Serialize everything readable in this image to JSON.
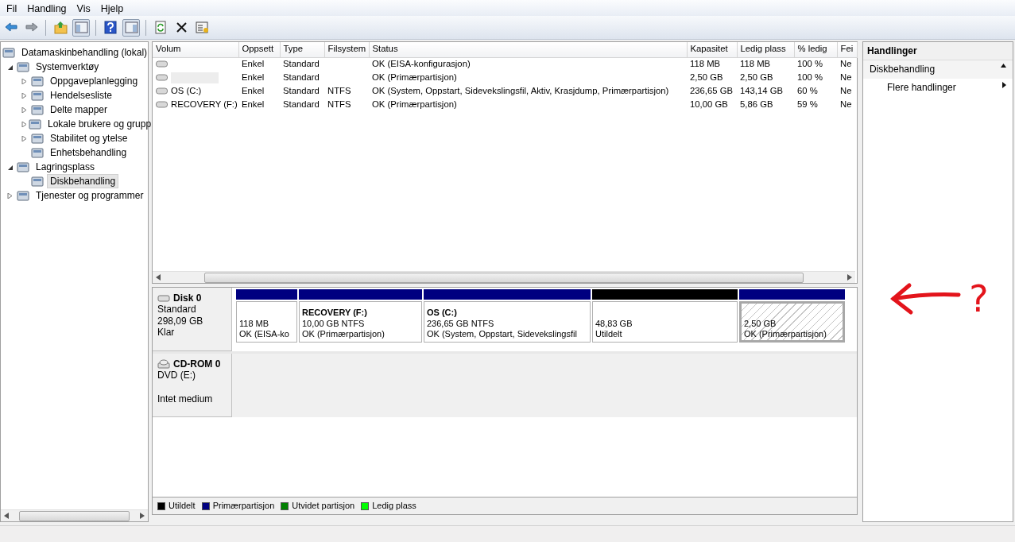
{
  "menu": [
    "Fil",
    "Handling",
    "Vis",
    "Hjelp"
  ],
  "toolbar": [
    {
      "kind": "back",
      "pressed": false
    },
    {
      "kind": "forward",
      "pressed": false
    },
    {
      "kind": "sep"
    },
    {
      "kind": "up",
      "pressed": false
    },
    {
      "kind": "tree",
      "pressed": true
    },
    {
      "kind": "sep"
    },
    {
      "kind": "help",
      "pressed": false
    },
    {
      "kind": "pane",
      "pressed": true
    },
    {
      "kind": "sep"
    },
    {
      "kind": "refresh",
      "pressed": false
    },
    {
      "kind": "delete",
      "pressed": false
    },
    {
      "kind": "properties",
      "pressed": false
    }
  ],
  "tree": [
    {
      "label": "Datamaskinbehandling (lokal)",
      "selected": false,
      "children": [
        {
          "label": "Systemverktøy",
          "expanded": true,
          "selected": false,
          "children": [
            {
              "label": "Oppgaveplanlegging",
              "expanded": false,
              "selected": false
            },
            {
              "label": "Hendelsesliste",
              "expanded": false,
              "selected": false
            },
            {
              "label": "Delte mapper",
              "expanded": false,
              "selected": false
            },
            {
              "label": "Lokale brukere og grupp",
              "expanded": false,
              "selected": false
            },
            {
              "label": "Stabilitet og ytelse",
              "expanded": false,
              "selected": false
            },
            {
              "label": "Enhetsbehandling",
              "selected": false
            }
          ]
        },
        {
          "label": "Lagringsplass",
          "expanded": true,
          "selected": false,
          "children": [
            {
              "label": "Diskbehandling",
              "selected": true
            }
          ]
        },
        {
          "label": "Tjenester og programmer",
          "expanded": false,
          "selected": false
        }
      ]
    }
  ],
  "table": {
    "columns": [
      "Volum",
      "Oppsett",
      "Type",
      "Filsystem",
      "Status",
      "Kapasitet",
      "Ledig plass",
      "% ledig",
      "Fei"
    ],
    "rows": [
      {
        "blurred": false,
        "cells": [
          "",
          "Enkel",
          "Standard",
          "",
          "OK (EISA-konfigurasjon)",
          "118 MB",
          "118 MB",
          "100 %",
          "Ne"
        ]
      },
      {
        "blurred": true,
        "cells": [
          "",
          "Enkel",
          "Standard",
          "",
          "OK (Primærpartisjon)",
          "2,50 GB",
          "2,50 GB",
          "100 %",
          "Ne"
        ]
      },
      {
        "blurred": false,
        "cells": [
          "OS (C:)",
          "Enkel",
          "Standard",
          "NTFS",
          "OK (System, Oppstart, Sidevekslingsfil, Aktiv, Krasjdump, Primærpartisjon)",
          "236,65 GB",
          "143,14 GB",
          "60 %",
          "Ne"
        ]
      },
      {
        "blurred": false,
        "cells": [
          "RECOVERY (F:)",
          "Enkel",
          "Standard",
          "NTFS",
          "OK (Primærpartisjon)",
          "10,00 GB",
          "5,86 GB",
          "59 %",
          "Ne"
        ]
      }
    ]
  },
  "disks": [
    {
      "kind": "disk",
      "name": "Disk 0",
      "lines": [
        "Standard",
        "298,09 GB",
        "Klar"
      ],
      "partitions": [
        {
          "kind": "primary",
          "selected": false,
          "size": "118 MB",
          "status": "OK (EISA-ko"
        },
        {
          "kind": "primary",
          "selected": false,
          "title": "RECOVERY  (F:)",
          "size": "10,00 GB NTFS",
          "status": "OK (Primærpartisjon)"
        },
        {
          "kind": "primary",
          "selected": false,
          "title": "OS  (C:)",
          "size": "236,65 GB NTFS",
          "status": "OK (System, Oppstart, Sidevekslingsfil"
        },
        {
          "kind": "unallocated",
          "selected": false,
          "size": "48,83 GB",
          "status": "Utildelt"
        },
        {
          "kind": "primary",
          "selected": true,
          "size": "2,50 GB",
          "status": "OK (Primærpartisjon)"
        }
      ]
    },
    {
      "kind": "cdrom",
      "name": "CD-ROM 0",
      "lines": [
        "DVD (E:)",
        "Intet medium"
      ]
    }
  ],
  "legend": [
    {
      "label": "Utildelt",
      "color": "#000000"
    },
    {
      "label": "Primærpartisjon",
      "color": "#000080"
    },
    {
      "label": "Utvidet partisjon",
      "color": "#008000"
    },
    {
      "label": "Ledig plass",
      "color": "#00ff00"
    }
  ],
  "actions": {
    "title": "Handlinger",
    "sections": [
      {
        "label": "Diskbehandling",
        "expanded": true,
        "items": [
          "Flere handlinger"
        ]
      }
    ]
  },
  "annotation": {
    "text": "?"
  }
}
